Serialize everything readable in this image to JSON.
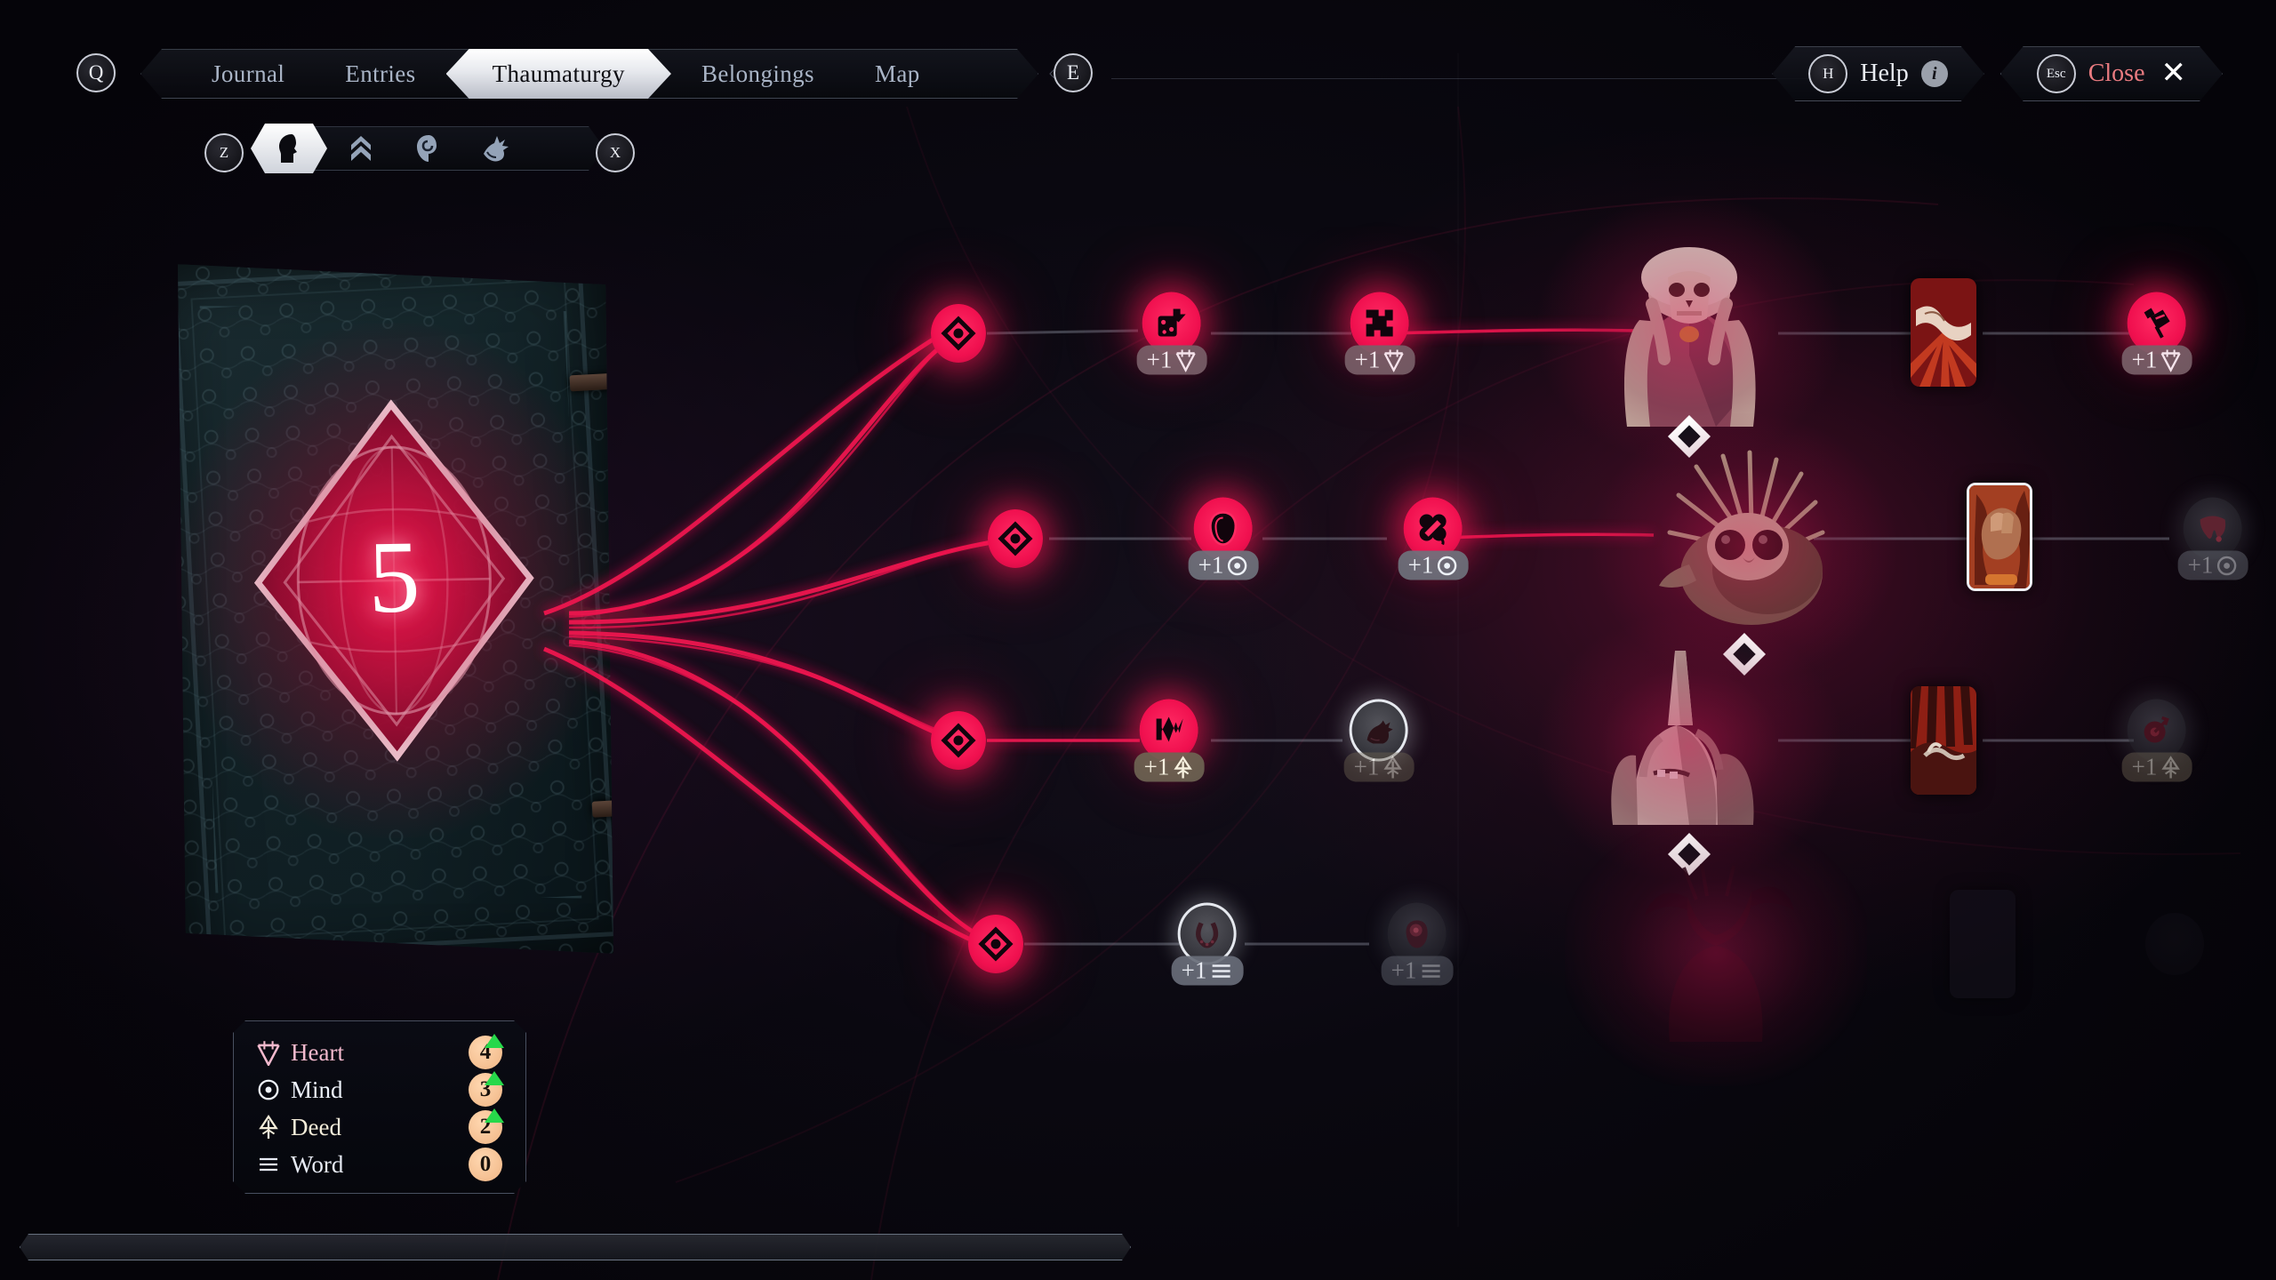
{
  "window": {
    "title": "Thaumaturgy"
  },
  "topbar": {
    "left_key": "Q",
    "right_key": "E",
    "tabs": [
      {
        "label": "Journal",
        "active": false
      },
      {
        "label": "Entries",
        "active": false
      },
      {
        "label": "Thaumaturgy",
        "active": true
      },
      {
        "label": "Belongings",
        "active": false
      },
      {
        "label": "Map",
        "active": false
      }
    ],
    "help": {
      "key": "H",
      "label": "Help",
      "info_glyph": "i"
    },
    "close": {
      "key": "Esc",
      "label": "Close",
      "glyph": "✕"
    }
  },
  "subbar": {
    "prev_key": "Z",
    "next_key": "X",
    "items": [
      {
        "icon": "head-silhouette-icon",
        "active": true
      },
      {
        "icon": "double-chevron-icon",
        "active": false
      },
      {
        "icon": "spiral-eye-icon",
        "active": false
      },
      {
        "icon": "beast-claw-icon",
        "active": false
      }
    ]
  },
  "book": {
    "sigil_value": "5",
    "sigil_icon": "diamond-web-sigil"
  },
  "tree": {
    "rows": [
      {
        "id": "row-heart",
        "hub": {
          "icon": "diamond-eye-icon",
          "state": "active"
        },
        "nodes": [
          {
            "icon": "dice-icon",
            "state": "active",
            "bonus": "+1",
            "stat": "heart"
          },
          {
            "icon": "puzzle-piece-icon",
            "state": "active",
            "bonus": "+1",
            "stat": "heart"
          }
        ],
        "portrait": {
          "name": "skeleton-noble-portrait",
          "state": "unlocked"
        },
        "card": {
          "name": "clasped-hands-card",
          "state": "unlocked"
        },
        "far_node": {
          "icon": "syringe-icon",
          "state": "active",
          "bonus": "+1",
          "stat": "heart"
        }
      },
      {
        "id": "row-mind",
        "hub": {
          "icon": "diamond-eye-icon",
          "state": "active"
        },
        "nodes": [
          {
            "icon": "head-outline-icon",
            "state": "active",
            "bonus": "+1",
            "stat": "mind"
          },
          {
            "icon": "clover-icon",
            "state": "active",
            "bonus": "+1",
            "stat": "mind"
          }
        ],
        "portrait": {
          "name": "feathered-owl-creature-portrait",
          "state": "unlocked"
        },
        "card": {
          "name": "burning-fist-card",
          "state": "selected"
        },
        "far_node": {
          "icon": "tooth-icon",
          "state": "dim",
          "bonus": "+1",
          "stat": "mind"
        }
      },
      {
        "id": "row-deed",
        "hub": {
          "icon": "diamond-eye-icon",
          "state": "active"
        },
        "nodes": [
          {
            "icon": "rune-arrow-icon",
            "state": "active",
            "bonus": "+1",
            "stat": "deed"
          },
          {
            "icon": "horse-icon",
            "state": "locked",
            "bonus": "+1",
            "stat": "deed"
          }
        ],
        "portrait": {
          "name": "horned-pale-creature-portrait",
          "state": "unlocked"
        },
        "card": {
          "name": "sunburst-hand-card",
          "state": "unlocked"
        },
        "far_node": {
          "icon": "target-dart-icon",
          "state": "dim",
          "bonus": "+1",
          "stat": "deed"
        }
      },
      {
        "id": "row-word",
        "hub": {
          "icon": "diamond-eye-icon",
          "state": "active"
        },
        "nodes": [
          {
            "icon": "horseshoe-icon",
            "state": "locked",
            "bonus": "+1",
            "stat": "word"
          },
          {
            "icon": "head-eye-icon",
            "state": "dim",
            "bonus": "+1",
            "stat": "word"
          }
        ],
        "portrait": {
          "name": "horned-silhouette-portrait",
          "state": "locked"
        },
        "card": {
          "name": "hidden-card",
          "state": "locked"
        },
        "far_node": {
          "icon": "hidden-node",
          "state": "hidden",
          "bonus": "",
          "stat": "word"
        }
      }
    ]
  },
  "stats": {
    "rows": [
      {
        "icon": "heart-rune-icon",
        "label": "Heart",
        "value": "4",
        "increase": true
      },
      {
        "icon": "mind-rune-icon",
        "label": "Mind",
        "value": "3",
        "increase": true
      },
      {
        "icon": "deed-rune-icon",
        "label": "Deed",
        "value": "2",
        "increase": true
      },
      {
        "icon": "word-rune-icon",
        "label": "Word",
        "value": "0",
        "increase": false
      }
    ]
  },
  "scrollbar": {
    "thumb_percent": 50
  },
  "colors": {
    "accent_pink": "#ff1a58",
    "accent_deep": "#c00c40",
    "panel_bg": "#0a0c14",
    "stat_value_bg": "#f0b584",
    "increase_green": "#27d84a",
    "close_red": "#e97b80",
    "text_muted": "#a9b4c6"
  }
}
